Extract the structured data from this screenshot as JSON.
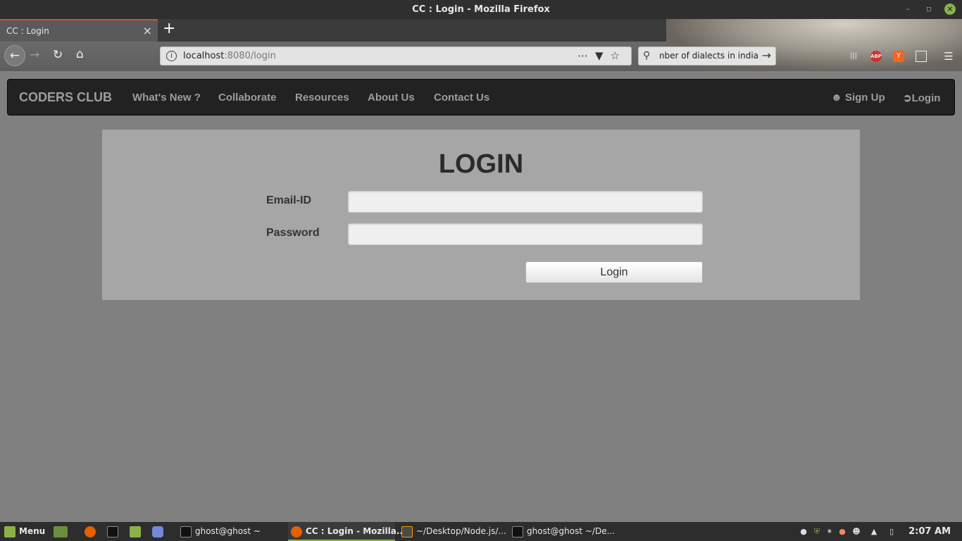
{
  "window": {
    "title": "CC : Login - Mozilla Firefox"
  },
  "browser": {
    "tab_title": "CC : Login",
    "url_host": "localhost",
    "url_rest": ":8080/login",
    "search_query": "umber of dialects in india"
  },
  "site": {
    "brand": "CODERS CLUB",
    "nav": [
      "What's New ?",
      "Collaborate",
      "Resources",
      "About Us",
      "Contact Us"
    ],
    "signup_label": "Sign Up",
    "login_label": "Login"
  },
  "form": {
    "heading": "LOGIN",
    "email_label": "Email-ID",
    "email_value": "",
    "password_label": "Password",
    "password_value": "",
    "submit_label": "Login"
  },
  "taskbar": {
    "menu_label": "Menu",
    "windows": [
      "ghost@ghost ~",
      "CC : Login - Mozilla...",
      "~/Desktop/Node.js/...",
      "ghost@ghost ~/De..."
    ],
    "clock": "2:07 AM"
  },
  "colors": {
    "page_bg": "#808080",
    "navbar_bg": "#222222",
    "panel_bg": "#a6a6a6",
    "accent_green": "#8bb14a"
  }
}
